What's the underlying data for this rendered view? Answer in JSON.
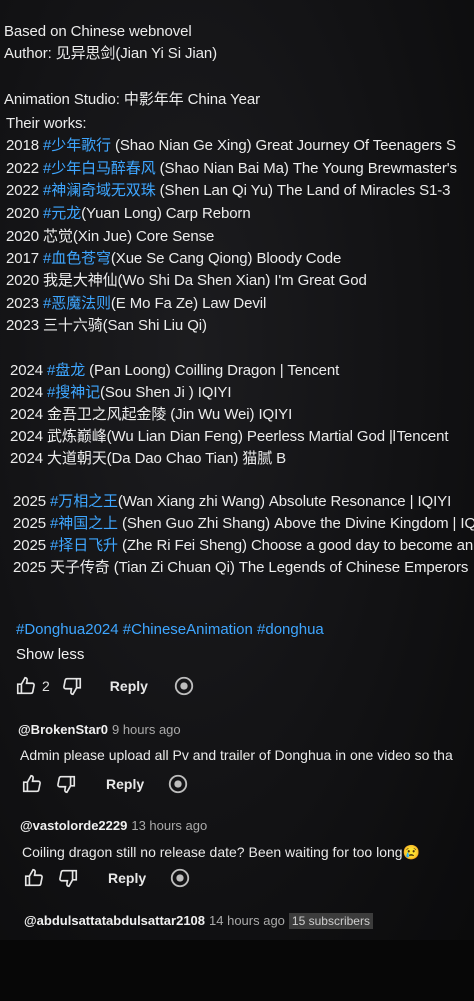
{
  "description": {
    "lines": [
      "Based on Chinese webnovel",
      "Author: 见异思剑(Jian Yi Si Jian)",
      "",
      "Animation Studio: 中影年年 China Year",
      "Their works:",
      "2018 #少年歌行 (Shao Nian Ge Xing) Great Journey Of Teenagers S",
      "2022 #少年白马醉春风 (Shao Nian Bai Ma) The Young Brewmaster's",
      "2022 #神澜奇域无双珠 (Shen Lan Qi Yu) The Land of Miracles S1-3",
      "2020 #元龙(Yuan Long) Carp Reborn",
      "2020 芯觉(Xin Jue) Core Sense",
      "2017 #血色苍穹(Xue Se Cang Qiong) Bloody Code",
      "2020 我是大神仙(Wo Shi Da Shen Xian) I'm Great God",
      "2023 #恶魔法则(E Mo Fa Ze) Law Devil",
      "2023 三十六骑(San Shi Liu Qi)",
      "",
      "2024 #盘龙 (Pan Loong) Coilling Dragon | Tencent",
      "2024 #搜神记(Sou Shen Ji ) IQIYI",
      "2024 金吾卫之风起金陵 (Jin Wu Wei) IQIYI",
      "2024 武炼巅峰(Wu Lian Dian Feng) Peerless Martial God | Tencent",
      "2024 大道朝天(Da Dao Chao Tian) 猫腻 B",
      "",
      "2025 #万相之王(Wan Xiang zhi Wang) Absolute Resonance | IQIYI",
      "2025 #神国之上 (Shen Guo Zhi Shang) Above the Divine Kingdom | IQ",
      "2025 #择日飞升 (Zhe Ri Fei Sheng) Choose a good day to become an",
      "2025 天子传奇 (Tian Zi Chuan Qi) The Legends of Chinese Emperors"
    ],
    "hashtags": "#Donghua2024 #ChineseAnimation #donghua",
    "show_less": "Show less",
    "likes": "2",
    "reply": "Reply"
  },
  "comments": [
    {
      "handle": "@BrokenStar0",
      "time": "9 hours ago",
      "text": "Admin please upload all Pv and trailer of Donghua in one video so tha",
      "reply": "Reply"
    },
    {
      "handle": "@vastolorde2229",
      "time": "13 hours ago",
      "text": "Coiling dragon still no release date? Been waiting for too long😢",
      "reply": "Reply"
    },
    {
      "handle": "@abdulsattatabdulsattar2108",
      "time": "14 hours ago",
      "badge": "15 subscribers"
    }
  ],
  "colors": {
    "link": "#3ea6ff",
    "background": "#121214"
  }
}
